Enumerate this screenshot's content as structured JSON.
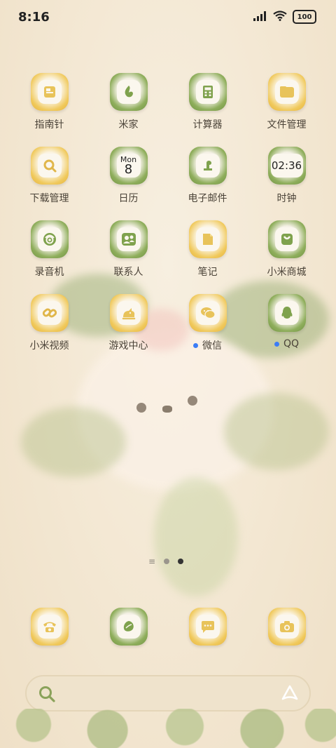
{
  "status_bar": {
    "time": "8:16",
    "battery": "100"
  },
  "apps": [
    {
      "label": "指南针",
      "icon": "compass-icon",
      "theme": "yellow",
      "dot": false
    },
    {
      "label": "米家",
      "icon": "mijia-icon",
      "theme": "green",
      "dot": false
    },
    {
      "label": "计算器",
      "icon": "calculator-icon",
      "theme": "green",
      "dot": false
    },
    {
      "label": "文件管理",
      "icon": "folder-icon",
      "theme": "yellow",
      "dot": false
    },
    {
      "label": "下载管理",
      "icon": "download-icon",
      "theme": "yellow",
      "dot": false
    },
    {
      "label": "日历",
      "icon": "calendar-icon",
      "theme": "green",
      "dot": false,
      "cal_day": "Mon",
      "cal_date": "8"
    },
    {
      "label": "电子邮件",
      "icon": "mail-icon",
      "theme": "green",
      "dot": false
    },
    {
      "label": "时钟",
      "icon": "clock-icon",
      "theme": "green",
      "dot": false,
      "clock_text": "02:36"
    },
    {
      "label": "录音机",
      "icon": "recorder-icon",
      "theme": "green",
      "dot": false
    },
    {
      "label": "联系人",
      "icon": "contacts-icon",
      "theme": "green",
      "dot": false
    },
    {
      "label": "笔记",
      "icon": "notes-icon",
      "theme": "yellow",
      "dot": false
    },
    {
      "label": "小米商城",
      "icon": "store-icon",
      "theme": "green",
      "dot": false
    },
    {
      "label": "小米视频",
      "icon": "video-icon",
      "theme": "yellow",
      "dot": false
    },
    {
      "label": "游戏中心",
      "icon": "game-center-icon",
      "theme": "yellow",
      "dot": false
    },
    {
      "label": "微信",
      "icon": "wechat-icon",
      "theme": "yellow",
      "dot": true
    },
    {
      "label": "QQ",
      "icon": "qq-icon",
      "theme": "green",
      "dot": true
    }
  ],
  "dock": [
    {
      "icon": "phone-icon",
      "theme": "yellow"
    },
    {
      "icon": "browser-icon",
      "theme": "green"
    },
    {
      "icon": "messages-icon",
      "theme": "yellow"
    },
    {
      "icon": "camera-icon",
      "theme": "yellow"
    }
  ],
  "page_indicator": {
    "pages": 2,
    "active": 2
  },
  "colors": {
    "yellow_accent": "#f0c95c",
    "green_accent": "#8fae5c",
    "notification_dot": "#3b7cf6"
  }
}
